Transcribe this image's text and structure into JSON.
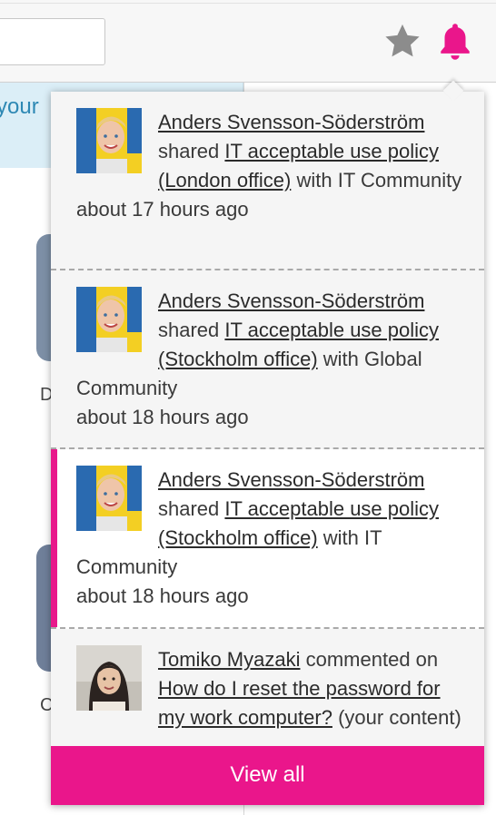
{
  "background": {
    "banner_text": "your",
    "tile_letters": [
      "D",
      "C"
    ]
  },
  "header": {
    "star_icon": "star-icon",
    "bell_icon": "bell-icon"
  },
  "colors": {
    "accent": "#ea168b",
    "star": "#8c8c8c"
  },
  "notifications": [
    {
      "actor": "Anders Svensson-Söderström",
      "verb": "shared",
      "object": "IT acceptable use policy (London office)",
      "suffix": "with IT Community",
      "time": "about 17 hours ago",
      "unread": false
    },
    {
      "actor": "Anders Svensson-Söderström",
      "verb": "shared",
      "object": "IT acceptable use policy (Stockholm office)",
      "suffix": "with Global Community",
      "time": "about 18 hours ago",
      "unread": false
    },
    {
      "actor": "Anders Svensson-Söderström",
      "verb": "shared",
      "object": "IT acceptable use policy (Stockholm office)",
      "suffix": "with IT Community",
      "time": "about 18 hours ago",
      "unread": true
    },
    {
      "actor": "Tomiko Myazaki",
      "verb": "commented on",
      "object": "How do I reset the password for my work computer?",
      "suffix": "(your content)",
      "time": "",
      "unread": false
    }
  ],
  "footer": {
    "view_all_label": "View all"
  }
}
